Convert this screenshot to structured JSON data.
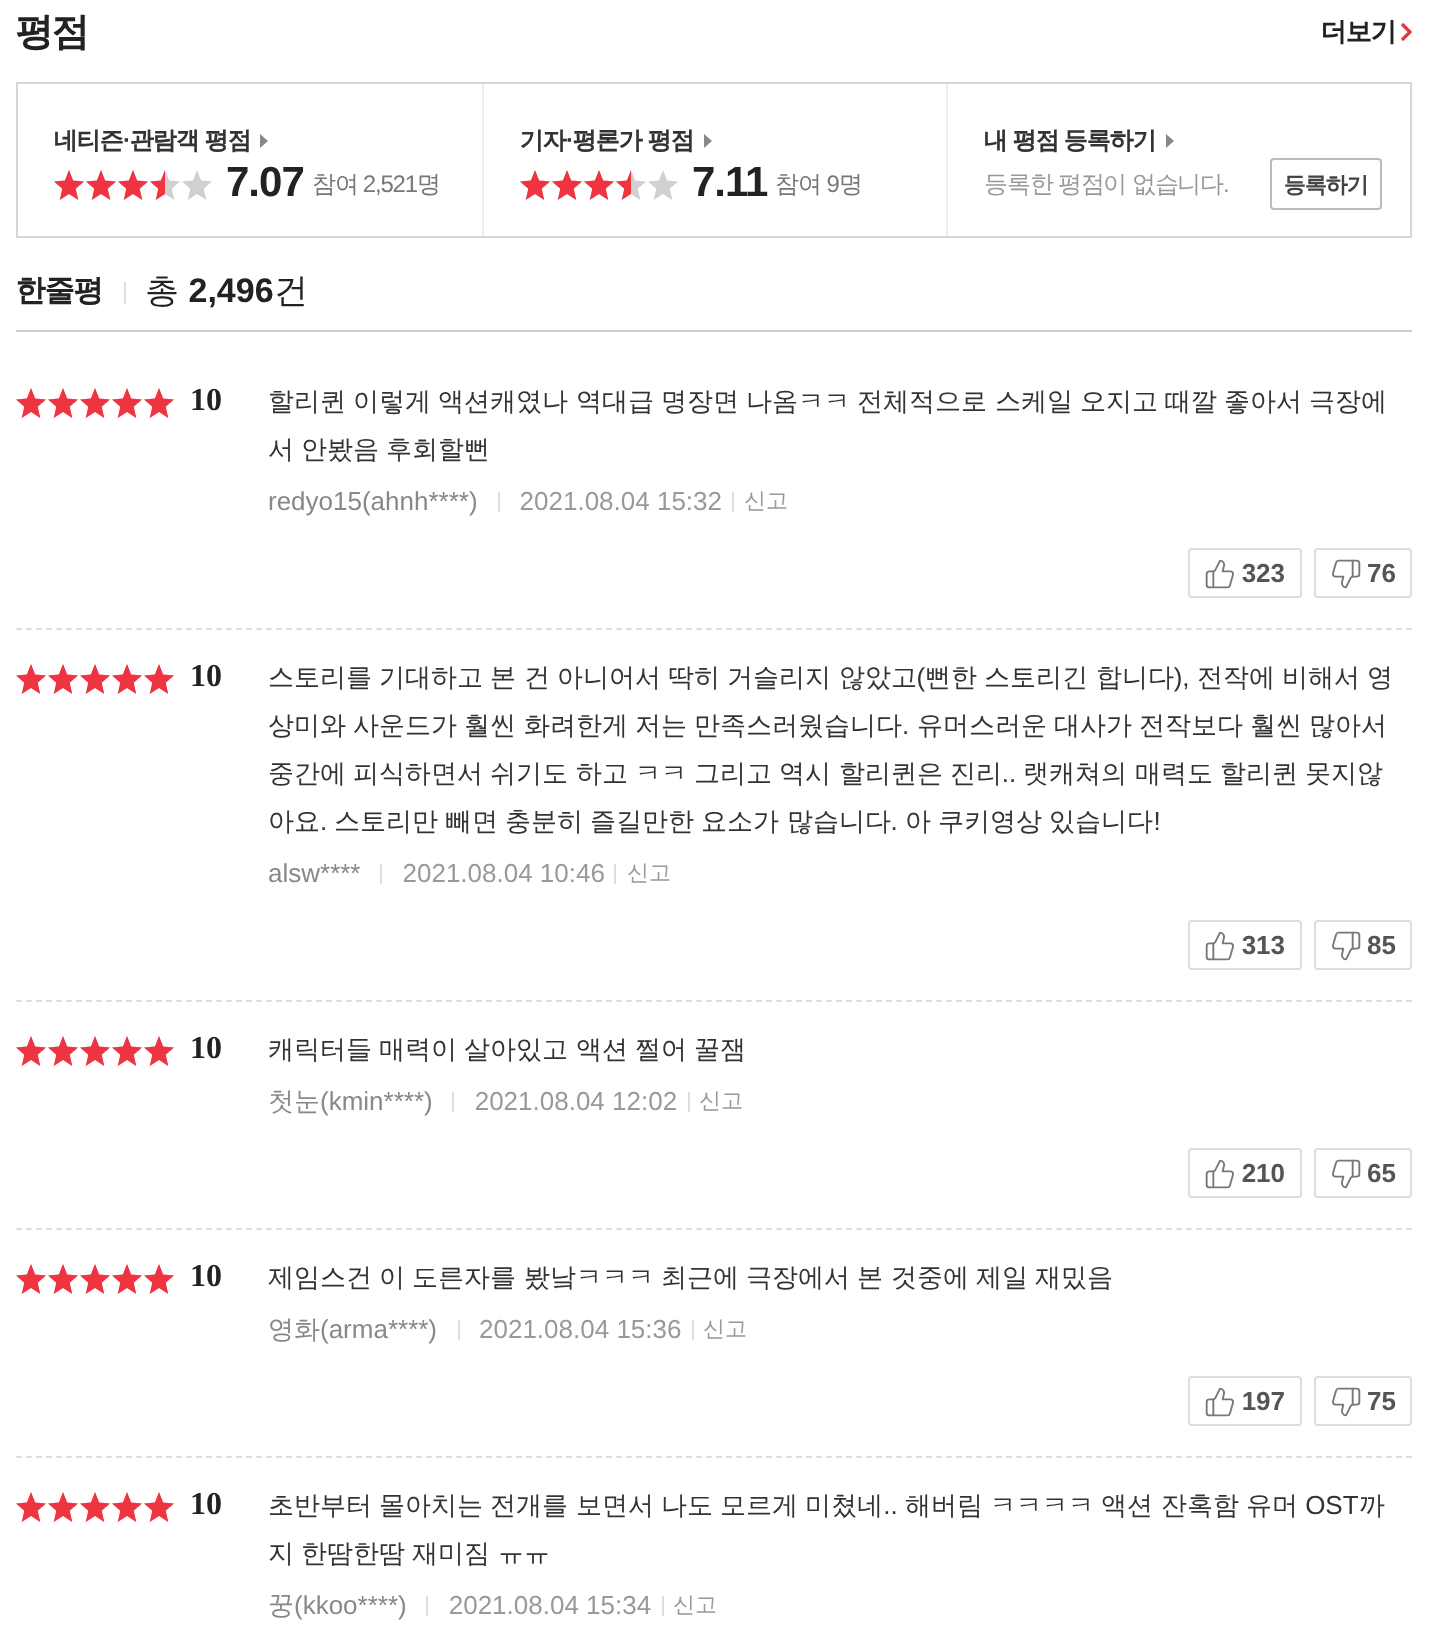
{
  "header": {
    "title": "평점",
    "more_link": "더보기"
  },
  "rating_summary": [
    {
      "kind": "rating",
      "label": "네티즌·관람객 평점",
      "stars": 3.5,
      "score": "7.07",
      "participants": "참여 2,521명"
    },
    {
      "kind": "rating",
      "label": "기자·평론가 평점",
      "stars": 3.5,
      "score": "7.11",
      "participants": "참여 9명"
    },
    {
      "kind": "register",
      "label": "내 평점 등록하기",
      "message": "등록한 평점이 없습니다.",
      "button": "등록하기"
    }
  ],
  "reviews_header": {
    "title": "한줄평",
    "total": "총 **2,496**건"
  },
  "reviews": [
    {
      "stars": 5,
      "score": "10",
      "text": "할리퀸 이렇게 액션캐였나 역대급 명장면 나옴ㅋㅋ 전체적으로 스케일 오지고 때깔 좋아서 극장에서 안봤음 후회할뻔",
      "author": "redyo15(ahnh****)",
      "date": "2021.08.04 15:32",
      "report": "신고",
      "likes": "323",
      "dislikes": "76"
    },
    {
      "stars": 5,
      "score": "10",
      "text": "스토리를 기대하고 본 건 아니어서 딱히 거슬리지 않았고(뻔한 스토리긴 합니다), 전작에 비해서 영상미와 사운드가 훨씬 화려한게 저는 만족스러웠습니다. 유머스러운 대사가 전작보다 훨씬 많아서 중간에 피식하면서 쉬기도 하고 ㅋㅋ 그리고 역시 할리퀸은 진리.. 랫캐쳐의 매력도 할리퀸 못지않아요. 스토리만 빼면 충분히 즐길만한 요소가 많습니다. 아 쿠키영상 있습니다!",
      "author": "alsw****",
      "date": "2021.08.04 10:46",
      "report": "신고",
      "likes": "313",
      "dislikes": "85"
    },
    {
      "stars": 5,
      "score": "10",
      "text": "캐릭터들 매력이 살아있고 액션 쩔어 꿀잼",
      "author": "첫눈(kmin****)",
      "date": "2021.08.04 12:02",
      "report": "신고",
      "likes": "210",
      "dislikes": "65"
    },
    {
      "stars": 5,
      "score": "10",
      "text": "제임스건 이 도른자를 봤낰ㅋㅋㅋ 최근에 극장에서 본 것중에 제일 재밌음",
      "author": "영화(arma****)",
      "date": "2021.08.04 15:36",
      "report": "신고",
      "likes": "197",
      "dislikes": "75"
    },
    {
      "stars": 5,
      "score": "10",
      "text": "초반부터 몰아치는 전개를 보면서 나도 모르게 미쳤네.. 해버림 ㅋㅋㅋㅋ 액션 잔혹함 유머 OST까지 한땀한땀 재미짐 ㅠㅠ",
      "author": "꿍(kkoo****)",
      "date": "2021.08.04 15:34",
      "report": "신고"
    }
  ]
}
